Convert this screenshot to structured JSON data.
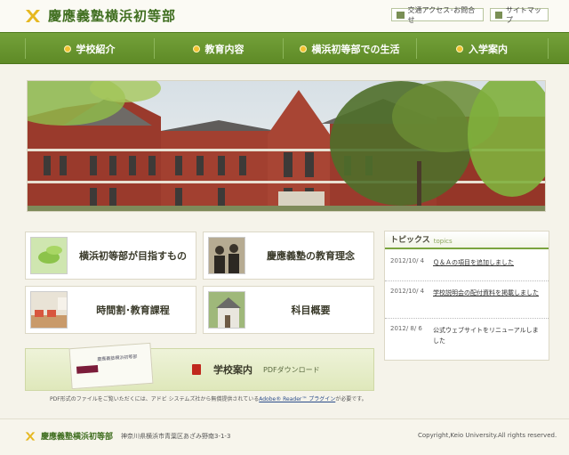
{
  "header": {
    "site_name": "慶應義塾横浜初等部",
    "access_link": "交通アクセス･お問合せ",
    "sitemap_link": "サイトマップ",
    "brand_color": "#3f6e1f"
  },
  "nav": {
    "items": [
      {
        "label": "学校紹介"
      },
      {
        "label": "教育内容"
      },
      {
        "label": "横浜初等部での生活"
      },
      {
        "label": "入学案内"
      }
    ],
    "color": "#6a9630"
  },
  "cards": [
    {
      "label": "横浜初等部が目指すもの"
    },
    {
      "label": "慶應義塾の教育理念"
    },
    {
      "label": "時間割･教育課程"
    },
    {
      "label": "科目概要"
    }
  ],
  "pdf": {
    "title": "学校案内",
    "subtitle": "PDFダウンロード",
    "note_prefix": "PDF形式のファイルをご覧いただくには、アドビ システムズ社から無償提供されている",
    "note_link": "Adobe® Reader™ プラグイン",
    "note_suffix": "が必要です。"
  },
  "topics": {
    "title": "トピックス",
    "subtitle": "topics",
    "items": [
      {
        "date": "2012/10/ 4",
        "text": "Ｑ＆Ａの項目を追加しました"
      },
      {
        "date": "2012/10/ 4",
        "text": "学校説明会の配付資料を掲載しました"
      },
      {
        "date": "2012/ 8/ 6",
        "text": "公式ウェブサイトをリニューアルしました"
      }
    ]
  },
  "footer": {
    "name": "慶應義塾横浜初等部",
    "address": "神奈川県横浜市青葉区あざみ野南3-1-3",
    "copyright": "Copyright,Keio University.All rights reserved."
  }
}
